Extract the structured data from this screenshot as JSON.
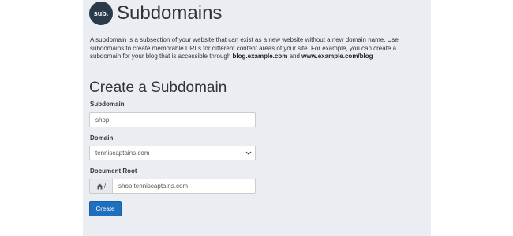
{
  "header": {
    "logo_text": "sub.",
    "title": "Subdomains"
  },
  "description": {
    "text_before": "A subdomain is a subsection of your website that can exist as a new website without a new domain name. Use subdomains to create memorable URLs for different content areas of your site. For example, you can create a subdomain for your blog that is accessible through ",
    "example1": "blog.example.com",
    "text_middle": " and ",
    "example2": "www.example.com/blog"
  },
  "form": {
    "section_title": "Create a Subdomain",
    "subdomain_label": "Subdomain",
    "subdomain_value": "shop",
    "domain_label": "Domain",
    "domain_selected": "tenniscaptains.com",
    "docroot_label": "Document Root",
    "docroot_prefix": "/",
    "docroot_value": "shop.tenniscaptains.com",
    "submit_label": "Create"
  },
  "colors": {
    "panel_bg": "#eaedf2",
    "logo_bg": "#293a4a",
    "button_bg": "#1f6fbf"
  },
  "icons": {
    "home": "home-icon",
    "dropdown": "chevron-down-icon"
  }
}
